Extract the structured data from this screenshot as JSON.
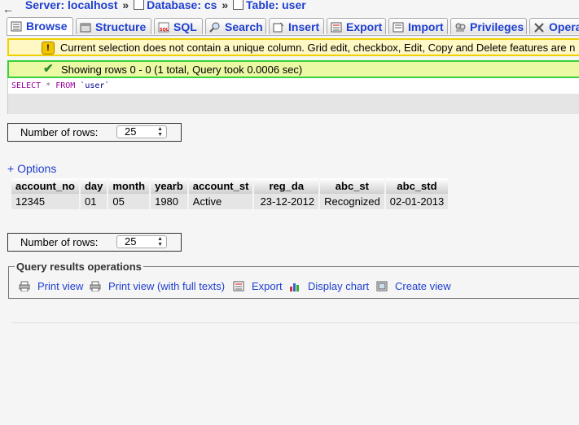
{
  "breadcrumb": {
    "server": "Server: localhost",
    "database": "Database: cs",
    "table": "Table: user",
    "sep": "»"
  },
  "tabs": [
    {
      "label": "Browse",
      "icon": "browse-icon"
    },
    {
      "label": "Structure",
      "icon": "structure-icon"
    },
    {
      "label": "SQL",
      "icon": "sql-icon"
    },
    {
      "label": "Search",
      "icon": "search-icon"
    },
    {
      "label": "Insert",
      "icon": "insert-icon"
    },
    {
      "label": "Export",
      "icon": "export-icon"
    },
    {
      "label": "Import",
      "icon": "import-icon"
    },
    {
      "label": "Privileges",
      "icon": "privileges-icon"
    },
    {
      "label": "Operat",
      "icon": "operations-icon"
    }
  ],
  "notice": "Current selection does not contain a unique column. Grid edit, checkbox, Edit, Copy and Delete features are n",
  "success": "Showing rows 0 - 0 (1 total, Query took 0.0006 sec)",
  "sql": {
    "select": "SELECT",
    "star": "*",
    "from": "FROM",
    "table": "`user`"
  },
  "num_rows": {
    "label": "Number of rows:",
    "value": "25"
  },
  "options_link": "+ Options",
  "table": {
    "columns": [
      "account_no",
      "day",
      "month",
      "yearb",
      "account_st",
      "reg_da",
      "abc_st",
      "abc_std"
    ],
    "rows": [
      [
        "12345",
        "01",
        "05",
        "1980",
        "Active",
        "23-12-2012",
        "Recognized",
        "02-01-2013"
      ]
    ]
  },
  "query_ops": {
    "legend": "Query results operations",
    "print_view": "Print view",
    "print_full": "Print view (with full texts)",
    "export": "Export",
    "display_chart": "Display chart",
    "create_view": "Create view"
  },
  "colors": {
    "link": "#1f3fd0",
    "notice_bg": "#fff8c4",
    "notice_border": "#f0d000",
    "success_bg": "#ebf8a4",
    "success_border": "#3ad13a"
  }
}
